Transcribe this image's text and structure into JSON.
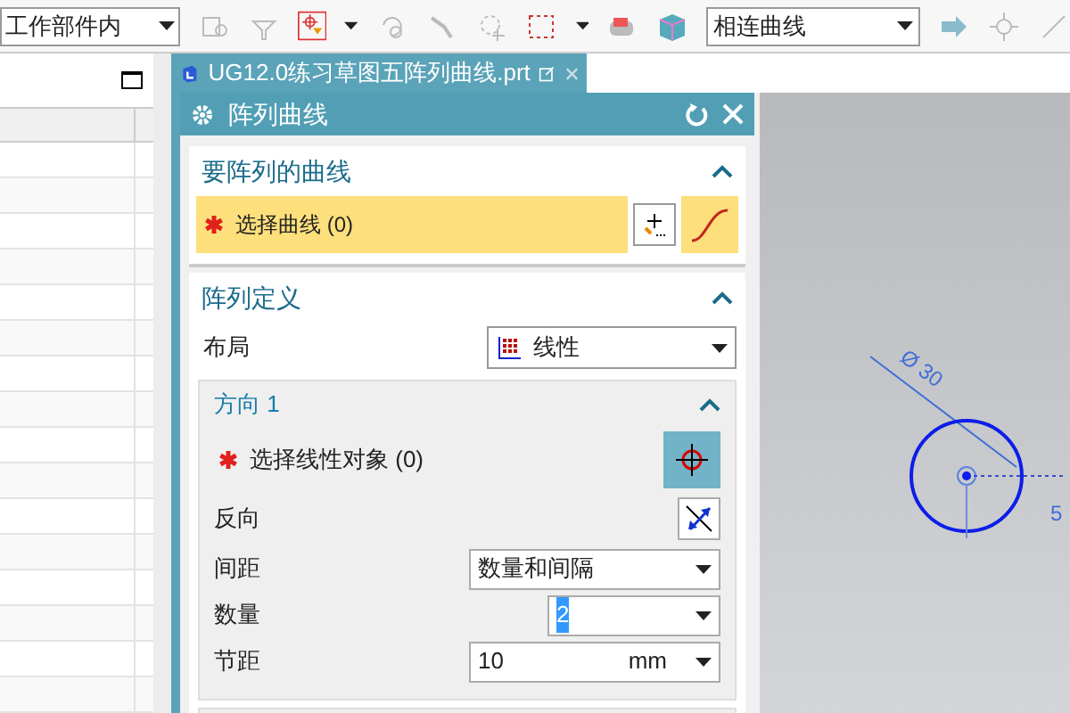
{
  "toolbar": {
    "scope_dropdown": "工作部件内",
    "curve_rule_dropdown": "相连曲线"
  },
  "document_tab": {
    "title": "UG12.0练习草图五阵列曲线.prt",
    "selected": true
  },
  "dialog": {
    "title": "阵列曲线",
    "curve_section": {
      "title": "要阵列的曲线",
      "expanded": true,
      "select_label": "选择曲线 (0)",
      "required": true
    },
    "definition_section": {
      "title": "阵列定义",
      "expanded": true,
      "layout_label": "布局",
      "layout_value": "线性",
      "direction1": {
        "title": "方向 1",
        "expanded": true,
        "select_label": "选择线性对象 (0)",
        "required": true,
        "reverse_label": "反向",
        "spacing_label": "间距",
        "spacing_value": "数量和间隔",
        "count_label": "数量",
        "count_value": "2",
        "count_text_selected": true,
        "pitch_label": "节距",
        "pitch_value": "10",
        "pitch_unit": "mm"
      }
    }
  },
  "canvas": {
    "diameter_dimension": "Ø 30",
    "horizontal_dimension": "5"
  }
}
